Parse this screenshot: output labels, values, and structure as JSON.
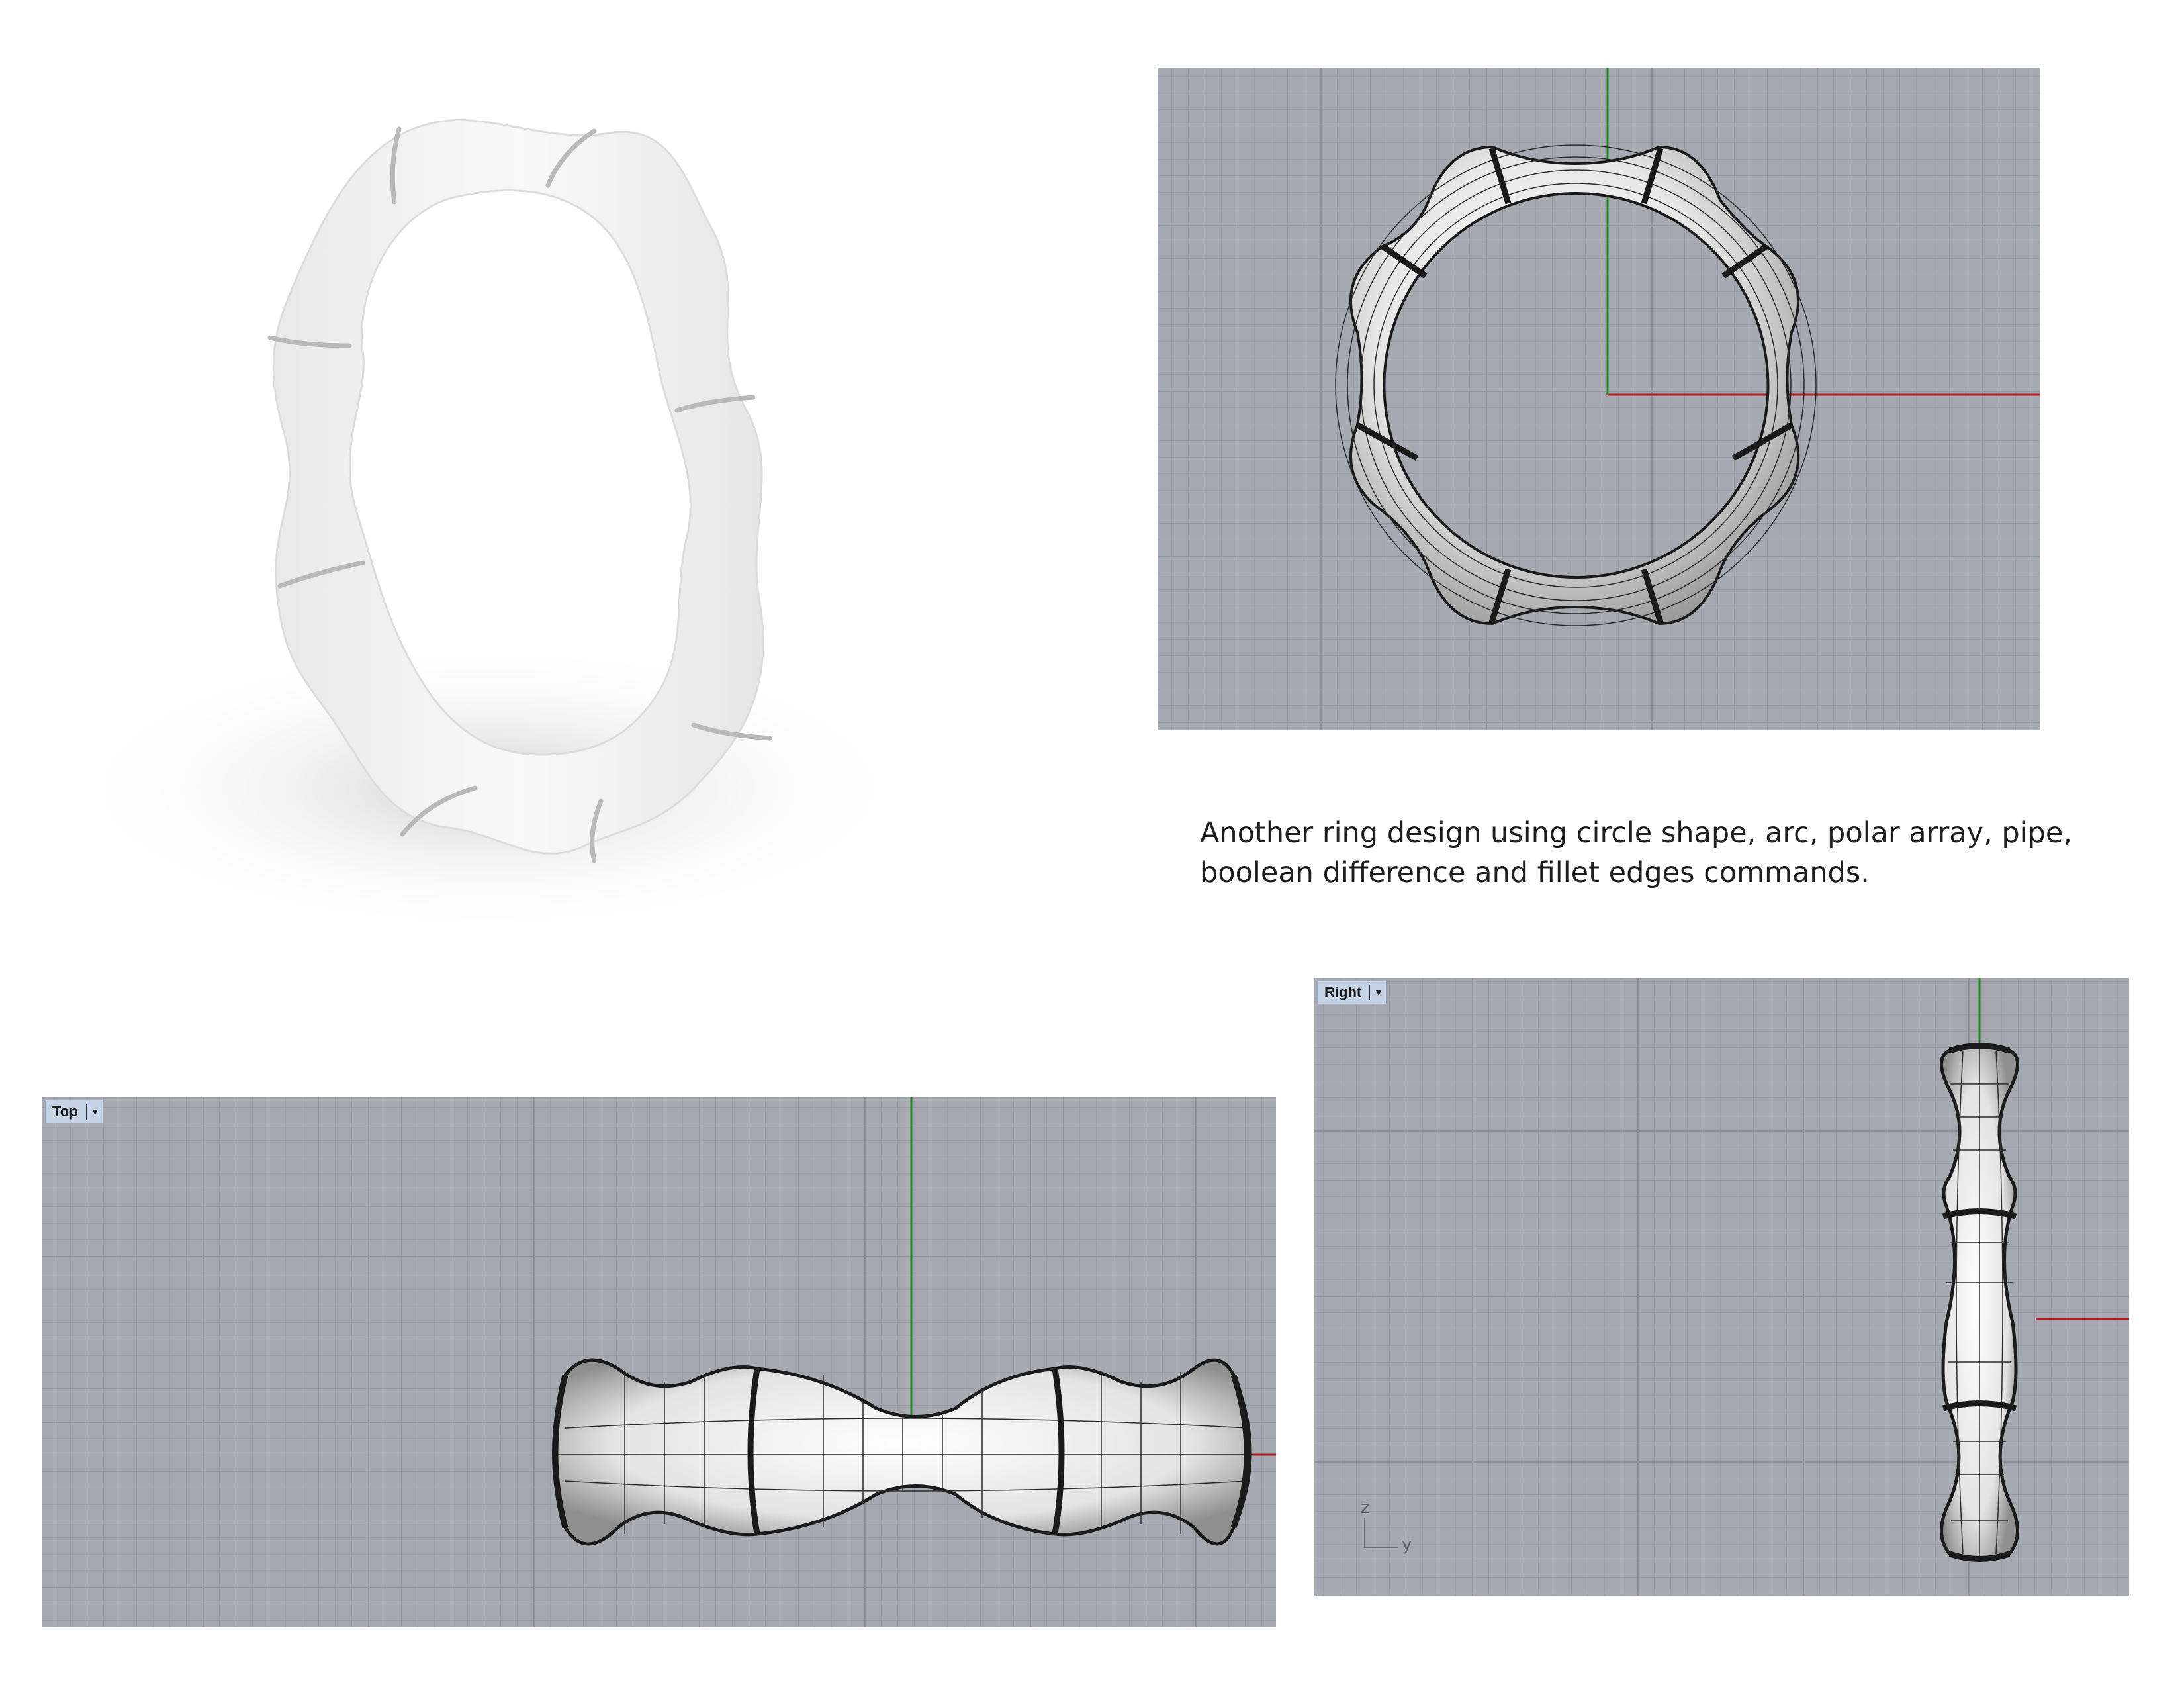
{
  "caption": {
    "line1": "Another ring design using circle shape, arc, polar array, pipe,",
    "line2": "boolean difference and fillet edges commands."
  },
  "viewports": {
    "top": {
      "label": "Top"
    },
    "right": {
      "label": "Right"
    },
    "perspective": {
      "label": ""
    }
  },
  "axis_widget": {
    "z": "z",
    "y": "y"
  },
  "colors": {
    "viewport_bg": "#a6a9b2",
    "grid_major": "#8e929c",
    "grid_minor": "#9b9ea7",
    "axis_x": "#b02020",
    "axis_y": "#1f8a1f",
    "label_bg": "#c5d3e6"
  },
  "icons": {
    "viewport_menu": "dropdown-triangle-icon"
  }
}
